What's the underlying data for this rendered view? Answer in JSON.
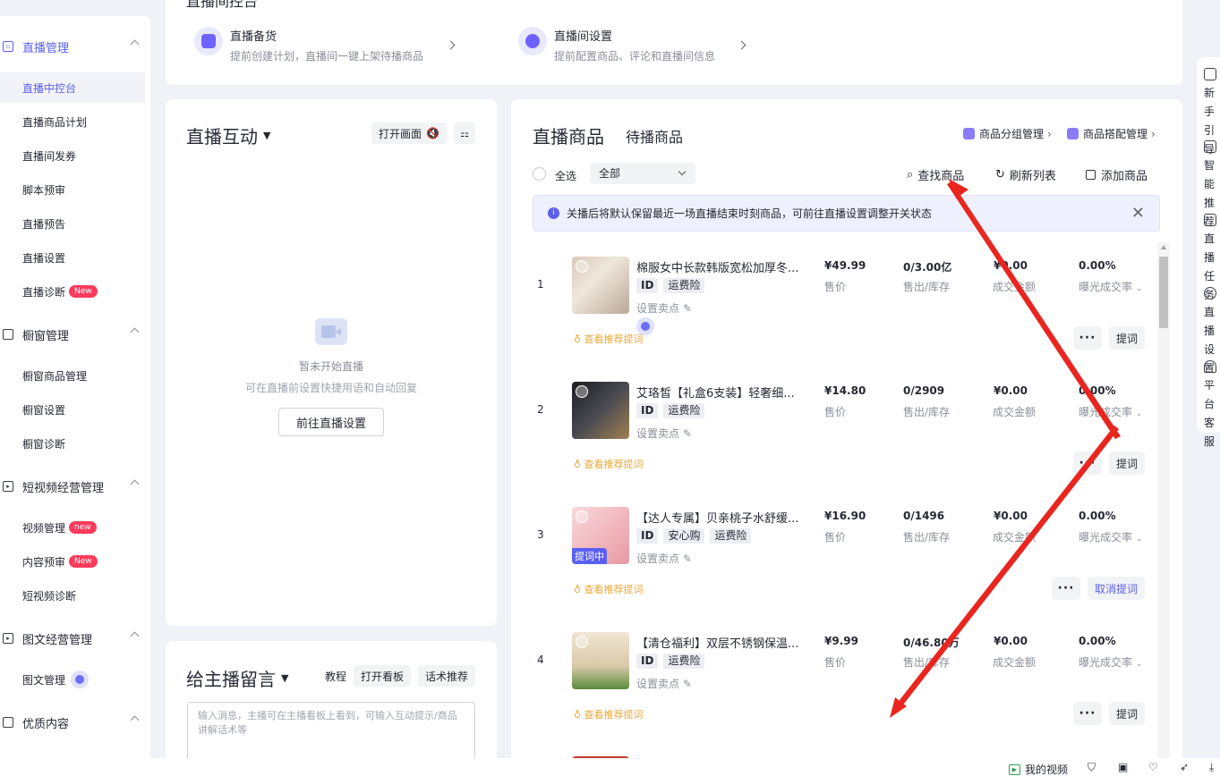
{
  "topcard": {
    "header_partial": "直播间控台",
    "items": [
      {
        "title": "直播备货",
        "sub": "提前创建计划，直播间一键上架待播商品"
      },
      {
        "title": "直播间设置",
        "sub": "提前配置商品、评论和直播间信息"
      }
    ]
  },
  "sidebar": {
    "groups": [
      {
        "label": "直播管理",
        "items": [
          "直播中控台",
          "直播商品计划",
          "直播间发券",
          "脚本预审",
          "直播预告",
          "直播设置",
          "直播诊断"
        ]
      },
      {
        "label": "橱窗管理",
        "items": [
          "橱窗商品管理",
          "橱窗设置",
          "橱窗诊断"
        ]
      },
      {
        "label": "短视频经营管理",
        "items": [
          "视频管理",
          "内容预审",
          "短视频诊断"
        ]
      },
      {
        "label": "图文经营管理",
        "items": [
          "图文管理"
        ]
      },
      {
        "label": "优质内容",
        "items": []
      }
    ],
    "badges": {
      "diag": "New",
      "video": "new",
      "review": "New"
    }
  },
  "interaction": {
    "title": "直播互动",
    "open_screen": "打开画面",
    "empty_title": "暂未开始直播",
    "empty_sub": "可在直播前设置快捷用语和自动回复",
    "goto_btn": "前往直播设置"
  },
  "message": {
    "title": "给主播留言",
    "tutorial": "教程",
    "open_board": "打开看板",
    "script_rec": "话术推荐",
    "placeholder": "输入消息，主播可在主播看板上看到，可输入互动提示/商品讲解话术等"
  },
  "goods": {
    "tab_active": "直播商品",
    "tab_other": "待播商品",
    "group_mgmt": "商品分组管理",
    "combo_mgmt": "商品搭配管理",
    "select_all": "全选",
    "filter_value": "全部",
    "find": "查找商品",
    "refresh": "刷新列表",
    "add": "添加商品",
    "notice": "关播后将默认保留最近一场直播结束时刻商品，可前往直播设置调整开关状态",
    "labels": {
      "price": "售价",
      "sold": "售出/库存",
      "gmv": "成交金额",
      "rate": "曝光成交率"
    },
    "set_point": "设置卖点",
    "hint": "查看推荐提词",
    "more": "···",
    "rows": [
      {
        "num": "1",
        "title": "棉服女中长款韩版宽松加厚冬...",
        "tags": [
          "运费险"
        ],
        "price": "¥49.99",
        "sold": "0/3.00亿",
        "gmv": "¥0.00",
        "rate": "0.00%",
        "action": "提词",
        "badge": ""
      },
      {
        "num": "2",
        "title": "艾珞皙【礼盒6支装】轻奢细...",
        "tags": [
          "运费险"
        ],
        "price": "¥14.80",
        "sold": "0/2909",
        "gmv": "¥0.00",
        "rate": "0.00%",
        "action": "提词",
        "badge": ""
      },
      {
        "num": "3",
        "title": "【达人专属】贝亲桃子水舒缓...",
        "tags": [
          "安心购",
          "运费险"
        ],
        "price": "¥16.90",
        "sold": "0/1496",
        "gmv": "¥0.00",
        "rate": "0.00%",
        "action": "取消提词",
        "badge": "提词中"
      },
      {
        "num": "4",
        "title": "【清仓福利】双层不锈钢保温...",
        "tags": [
          "运费险"
        ],
        "price": "¥9.99",
        "sold": "0/46.80万",
        "gmv": "¥0.00",
        "rate": "0.00%",
        "action": "提词",
        "badge": ""
      }
    ]
  },
  "rail": [
    {
      "l1": "新手",
      "l2": "引导"
    },
    {
      "l1": "智能",
      "l2": "推荐"
    },
    {
      "l1": "直播",
      "l2": "任务"
    },
    {
      "l1": "直播",
      "l2": "设置"
    },
    {
      "l1": "平台",
      "l2": "客服"
    }
  ],
  "bottombar": {
    "my_video": "我的视频"
  }
}
